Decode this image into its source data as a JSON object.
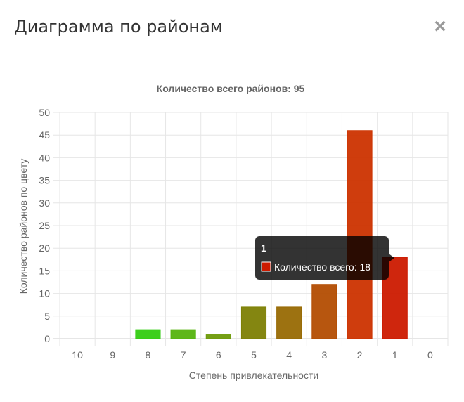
{
  "modal": {
    "title": "Диаграмма по районам",
    "close_glyph": "×"
  },
  "chart_data": {
    "type": "bar",
    "title": "Количество всего районов: 95",
    "xlabel": "Степень привлекательности",
    "ylabel": "Количество районов по цвету",
    "categories": [
      "10",
      "9",
      "8",
      "7",
      "6",
      "5",
      "4",
      "3",
      "2",
      "1",
      "0"
    ],
    "series": [
      {
        "values": [
          0,
          0,
          2,
          2,
          1,
          7,
          7,
          12,
          46,
          18,
          0
        ],
        "colors": [
          "#2ecc1c",
          "#33cc11",
          "#33cc11",
          "#55b30e",
          "#6e9a08",
          "#7d8004",
          "#986a04",
          "#b34d02",
          "#cc3300",
          "#cc1a00",
          "#cc0000"
        ]
      }
    ],
    "ylim": [
      0,
      50
    ],
    "yticks": [
      0,
      5,
      10,
      15,
      20,
      25,
      30,
      35,
      40,
      45,
      50
    ],
    "grid": true,
    "tooltip": {
      "category": "1",
      "label": "Количество всего: 18",
      "swatch_color": "#cc1a00"
    }
  }
}
